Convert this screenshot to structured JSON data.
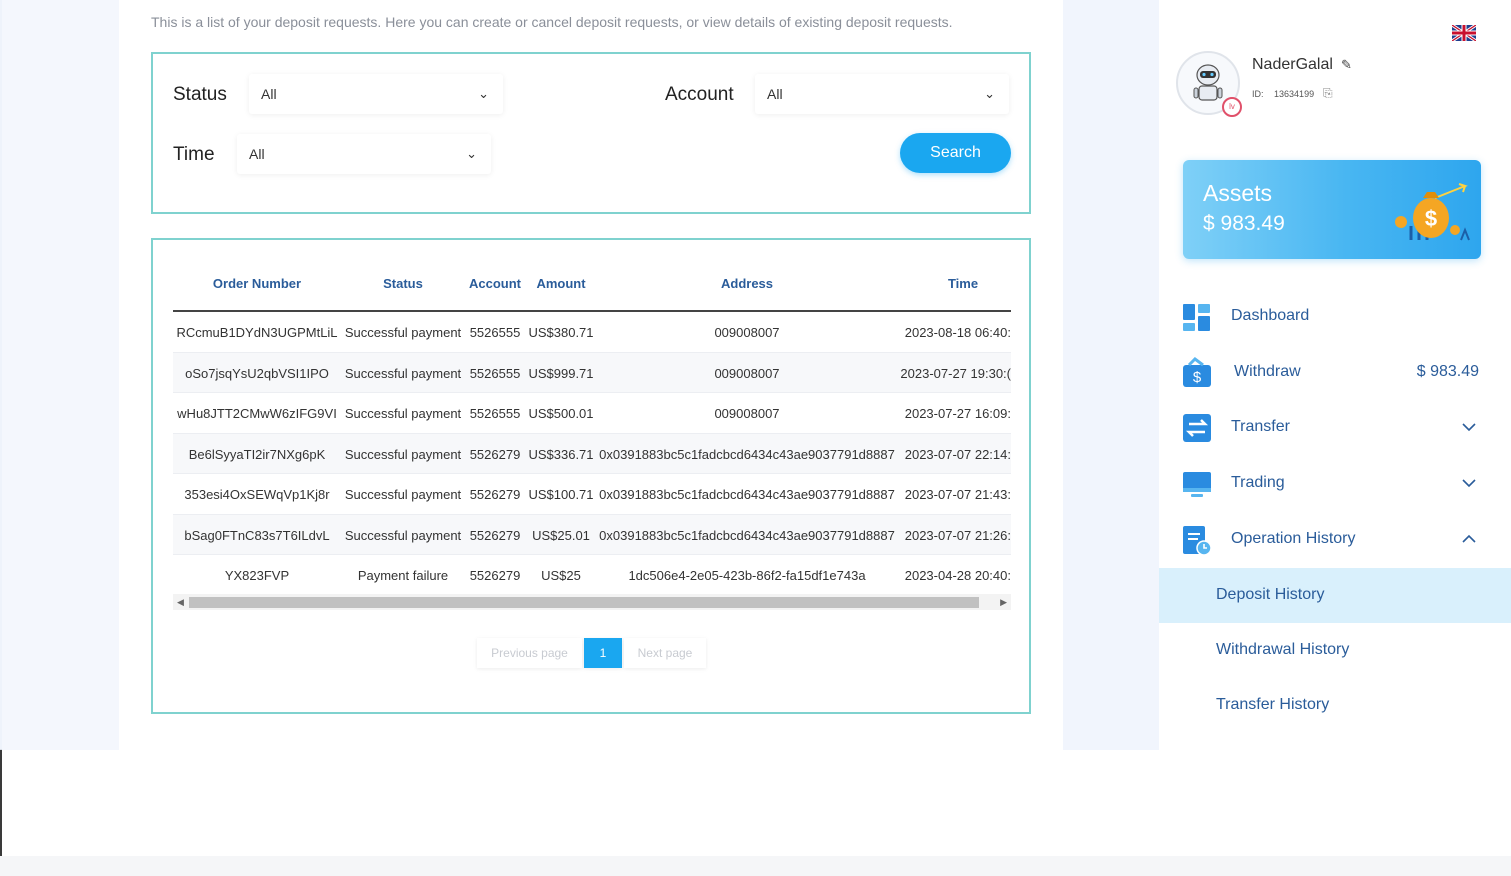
{
  "intro_text": "This is a list of your deposit requests. Here you can create or cancel deposit requests, or view details of existing deposit requests.",
  "filters": {
    "status_label": "Status",
    "status_value": "All",
    "account_label": "Account",
    "account_value": "All",
    "time_label": "Time",
    "time_value": "All",
    "search_label": "Search"
  },
  "table": {
    "columns": [
      "Order Number",
      "Status",
      "Account",
      "Amount",
      "Address",
      "Time"
    ],
    "rows": [
      [
        "RCcmuB1DYdN3UGPMtLiL",
        "Successful payment",
        "5526555",
        "US$380.71",
        "009008007",
        "2023-08-18 06:40:"
      ],
      [
        "oSo7jsqYsU2qbVSI1IPO",
        "Successful payment",
        "5526555",
        "US$999.71",
        "009008007",
        "2023-07-27 19:30:("
      ],
      [
        "wHu8JTT2CMwW6zIFG9VI",
        "Successful payment",
        "5526555",
        "US$500.01",
        "009008007",
        "2023-07-27 16:09:"
      ],
      [
        "Be6lSyyaTI2ir7NXg6pK",
        "Successful payment",
        "5526279",
        "US$336.71",
        "0x0391883bc5c1fadcbcd6434c43ae9037791d8887",
        "2023-07-07 22:14:"
      ],
      [
        "353esi4OxSEWqVp1Kj8r",
        "Successful payment",
        "5526279",
        "US$100.71",
        "0x0391883bc5c1fadcbcd6434c43ae9037791d8887",
        "2023-07-07 21:43:"
      ],
      [
        "bSag0FTnC83s7T6ILdvL",
        "Successful payment",
        "5526279",
        "US$25.01",
        "0x0391883bc5c1fadcbcd6434c43ae9037791d8887",
        "2023-07-07 21:26:"
      ],
      [
        "YX823FVP",
        "Payment failure",
        "5526279",
        "US$25",
        "1dc506e4-2e05-423b-86f2-fa15df1e743a",
        "2023-04-28 20:40:"
      ]
    ]
  },
  "pagination": {
    "previous": "Previous page",
    "current": "1",
    "next": "Next page"
  },
  "profile": {
    "username": "NaderGalal",
    "id_label": "ID:",
    "id_value": "13634199",
    "level_badge": "lv"
  },
  "assets": {
    "title": "Assets",
    "value": "$ 983.49"
  },
  "menu": {
    "dashboard": "Dashboard",
    "withdraw": "Withdraw",
    "withdraw_value": "$ 983.49",
    "transfer": "Transfer",
    "trading": "Trading",
    "operation_history": "Operation History",
    "deposit_history": "Deposit History",
    "withdrawal_history": "Withdrawal History",
    "transfer_history": "Transfer History"
  },
  "colors": {
    "accent": "#1aa7f0",
    "panel_border": "#7fd2cf",
    "menu_text": "#2a5c9a",
    "active_submenu_bg": "#d9f0fc"
  },
  "icons": {
    "flag": "uk-flag-icon",
    "edit": "pencil-icon",
    "copy": "copy-icon",
    "dashboard": "dashboard-icon",
    "withdraw": "wallet-icon",
    "transfer": "transfer-icon",
    "trading": "monitor-icon",
    "operation_history": "history-icon"
  }
}
